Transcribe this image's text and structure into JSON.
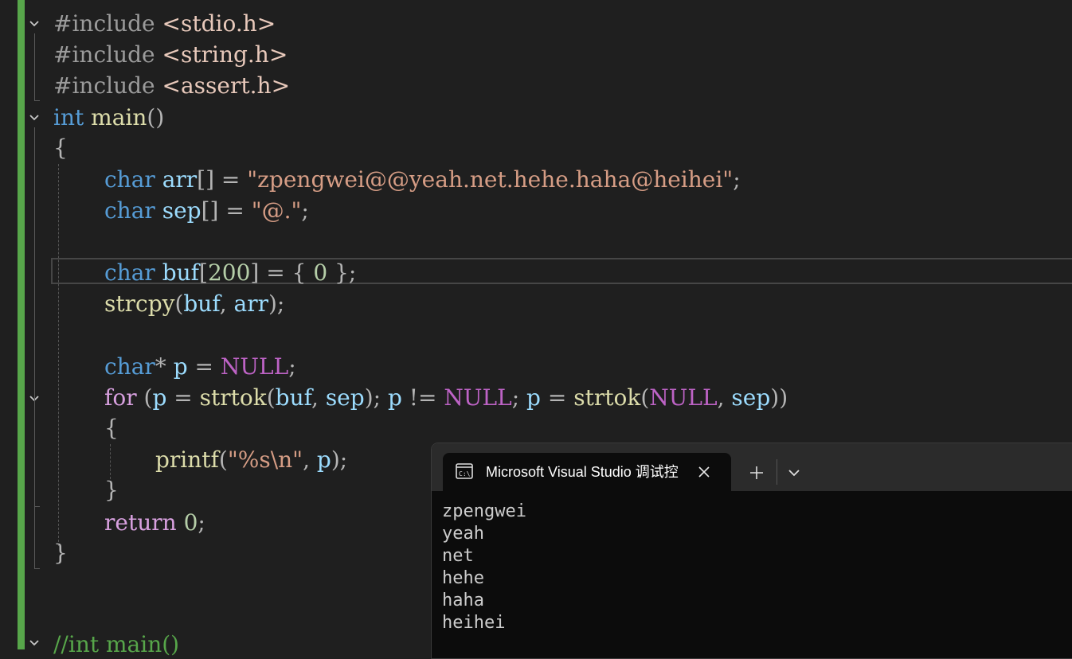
{
  "editor": {
    "lines": [
      [
        "#include",
        " ",
        "<stdio.h>"
      ],
      [
        "#include",
        " ",
        "<string.h>"
      ],
      [
        "#include",
        " ",
        "<assert.h>"
      ],
      [
        "int",
        " ",
        "main",
        "()"
      ],
      [
        "{"
      ],
      [
        "char",
        " ",
        "arr",
        "[] = ",
        "\"zpengwei@@yeah.net.hehe.haha@heihei\"",
        ";"
      ],
      [
        "char",
        " ",
        "sep",
        "[] = ",
        "\"@.\"",
        ";"
      ],
      [
        ""
      ],
      [
        "char",
        " ",
        "buf",
        "[",
        "200",
        "] = { ",
        "0",
        " };"
      ],
      [
        "strcpy",
        "(",
        "buf",
        ", ",
        "arr",
        ");"
      ],
      [
        ""
      ],
      [
        "char",
        "* ",
        "p",
        " = ",
        "NULL",
        ";"
      ],
      [
        "for",
        " (",
        "p",
        " = ",
        "strtok",
        "(",
        "buf",
        ", ",
        "sep",
        "); ",
        "p",
        " != ",
        "NULL",
        "; ",
        "p",
        " = ",
        "strtok",
        "(",
        "NULL",
        ", ",
        "sep",
        "))"
      ],
      [
        "{"
      ],
      [
        "printf",
        "(",
        "\"%s\\n\"",
        ", ",
        "p",
        ");"
      ],
      [
        "}"
      ],
      [
        "return",
        " ",
        "0",
        ";"
      ],
      [
        "}"
      ],
      [
        ""
      ],
      [
        ""
      ],
      [
        "//int main()"
      ]
    ]
  },
  "terminal": {
    "tab_title": "Microsoft Visual Studio 调试控",
    "tab_icon": "terminal-icon",
    "close_icon": "close-icon",
    "new_tab_icon": "plus-icon",
    "dropdown_icon": "chevron-down-icon",
    "output": [
      "zpengwei",
      "yeah",
      "net",
      "hehe",
      "haha",
      "heihei"
    ]
  }
}
